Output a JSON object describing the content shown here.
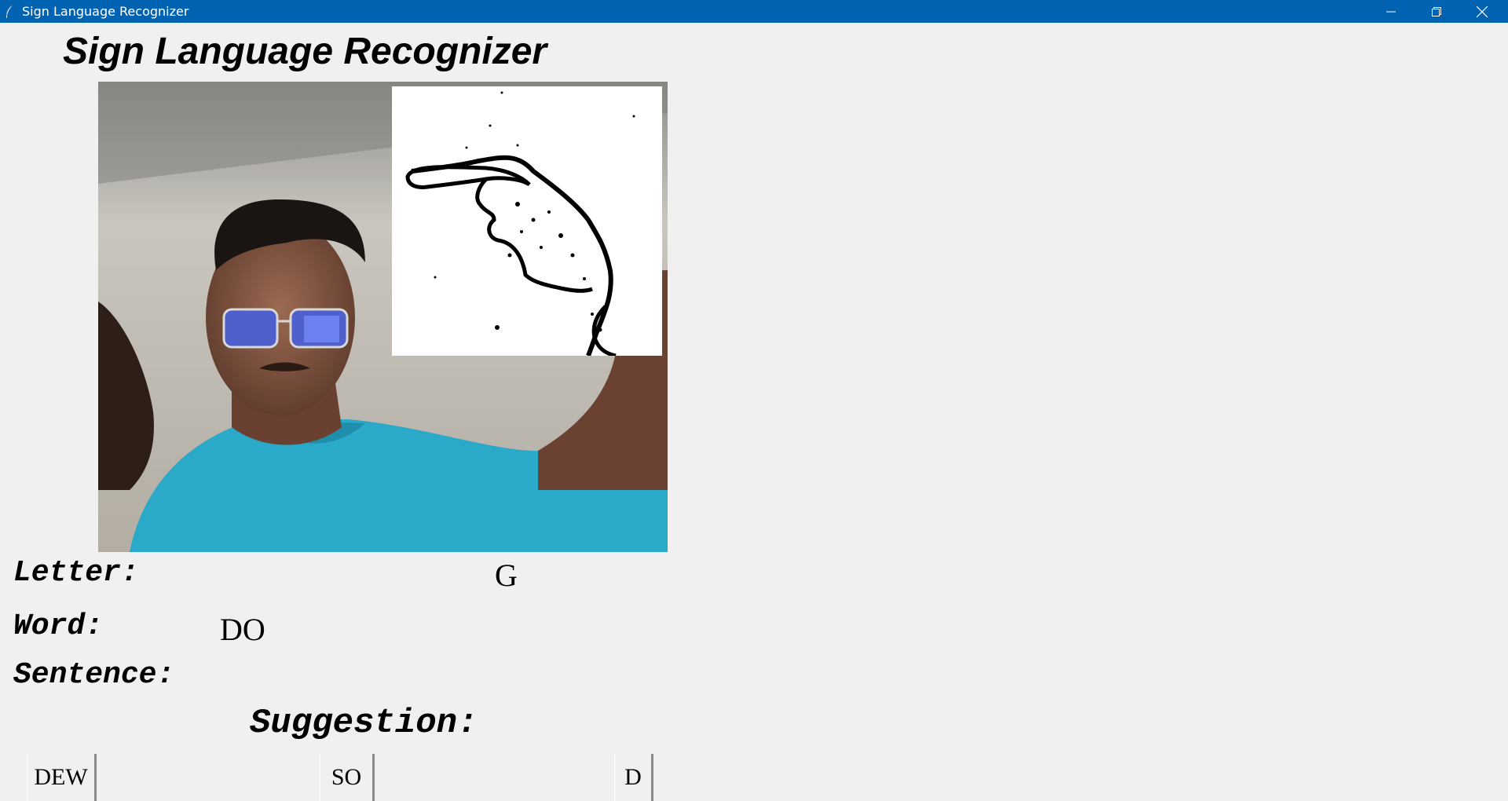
{
  "window": {
    "title": "Sign Language Recognizer",
    "icon": "feather-icon",
    "controls": [
      "minimize-icon",
      "restore-icon",
      "close-icon"
    ]
  },
  "app": {
    "heading": "Sign Language Recognizer"
  },
  "results": {
    "letter_label": "Letter:",
    "letter_value": "G",
    "word_label": "Word:",
    "word_value": "DO",
    "sentence_label": "Sentence:",
    "sentence_value": "",
    "suggestion_label": "Suggestion:"
  },
  "suggestions": [
    "DEW",
    "SO",
    "D"
  ],
  "colors": {
    "titlebar": "#0063b1",
    "background": "#f0f0f0"
  }
}
